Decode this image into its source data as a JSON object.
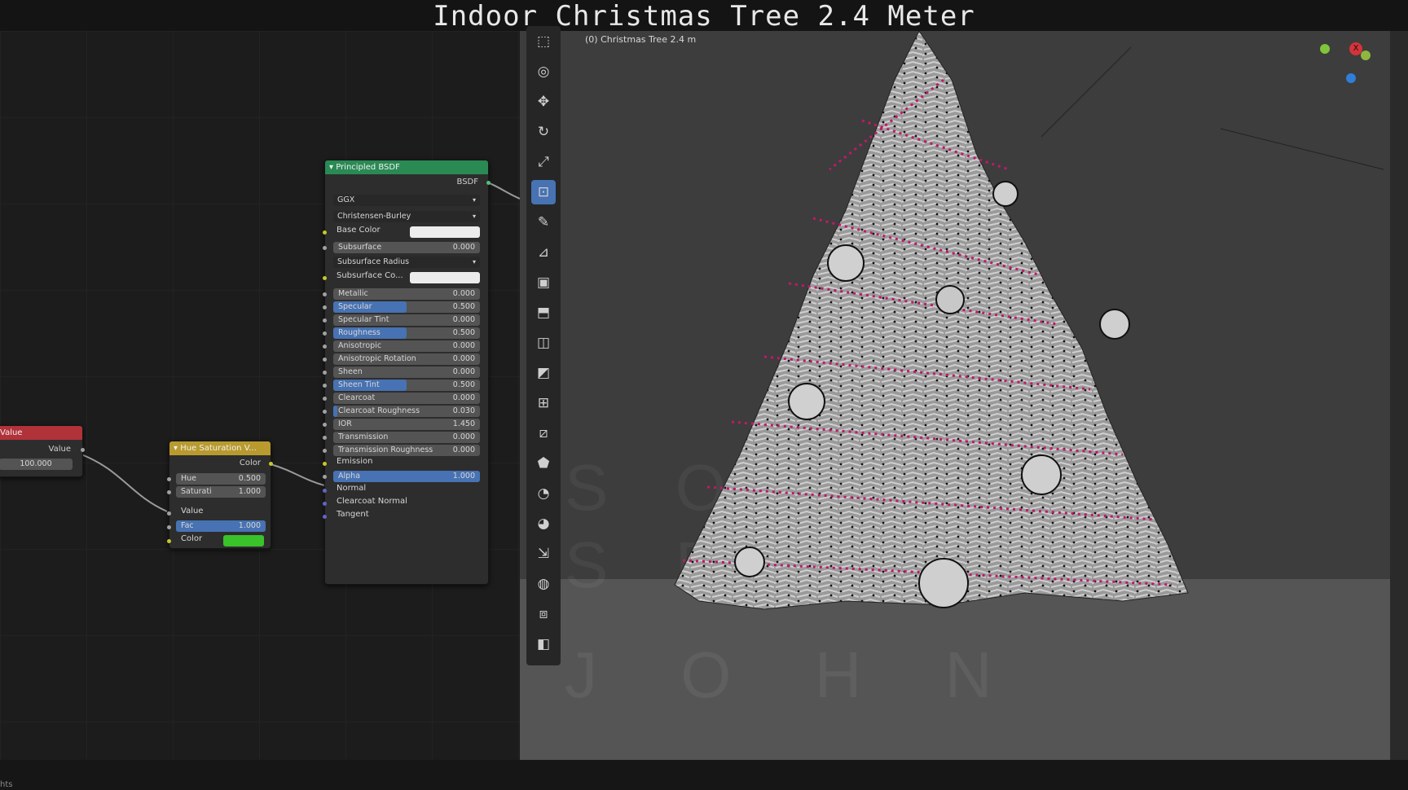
{
  "video_title": "Indoor Christmas Tree 2.4 Meter",
  "viewport": {
    "object_label": "(0) Christmas Tree 2.4 m",
    "watermark_lines": [
      "S O F",
      "S E",
      "J O H N"
    ],
    "gizmo_x_label": "X"
  },
  "nodes": {
    "value_node": {
      "title": "Value",
      "output_label": "Value",
      "value": "100.000",
      "header_color": "#b2323a"
    },
    "hue_sat_node": {
      "title": "Hue Saturation V...",
      "output_label": "Color",
      "header_color": "#b89a2e",
      "fields": [
        {
          "label": "Hue",
          "value": "0.500",
          "fill": 0
        },
        {
          "label": "Saturati",
          "value": "1.000",
          "fill": 0
        }
      ],
      "value_label": "Value",
      "fac": {
        "label": "Fac",
        "value": "1.000",
        "fill": 1.0
      },
      "color_label": "Color",
      "color_swatch": "#39c22a"
    },
    "bsdf_node": {
      "title": "Principled BSDF",
      "header_color": "#2a8a54",
      "output_label": "BSDF",
      "distribution": "GGX",
      "subsurface_method": "Christensen-Burley",
      "base_color_label": "Base Color",
      "subsurface_color_label": "Subsurface Co...",
      "subsurface_radius_label": "Subsurface Radius",
      "fields": [
        {
          "label": "Subsurface",
          "value": "0.000",
          "fill": 0
        },
        {
          "label": "Metallic",
          "value": "0.000",
          "fill": 0
        },
        {
          "label": "Specular",
          "value": "0.500",
          "fill": 0.5
        },
        {
          "label": "Specular Tint",
          "value": "0.000",
          "fill": 0
        },
        {
          "label": "Roughness",
          "value": "0.500",
          "fill": 0.5
        },
        {
          "label": "Anisotropic",
          "value": "0.000",
          "fill": 0
        },
        {
          "label": "Anisotropic Rotation",
          "value": "0.000",
          "fill": 0
        },
        {
          "label": "Sheen",
          "value": "0.000",
          "fill": 0
        },
        {
          "label": "Sheen Tint",
          "value": "0.500",
          "fill": 0.5
        },
        {
          "label": "Clearcoat",
          "value": "0.000",
          "fill": 0
        },
        {
          "label": "Clearcoat Roughness",
          "value": "0.030",
          "fill": 0.03
        },
        {
          "label": "IOR",
          "value": "1.450",
          "fill": 0
        },
        {
          "label": "Transmission",
          "value": "0.000",
          "fill": 0
        },
        {
          "label": "Transmission Roughness",
          "value": "0.000",
          "fill": 0
        },
        {
          "label": "Alpha",
          "value": "1.000",
          "fill": 1.0
        }
      ],
      "inputs_plain": [
        "Emission",
        "Normal",
        "Clearcoat Normal",
        "Tangent"
      ]
    }
  },
  "toolbar": {
    "tools": [
      "select-box-icon",
      "cursor-icon",
      "move-icon",
      "rotate-icon",
      "scale-icon",
      "transform-icon",
      "annotate-icon",
      "measure-icon",
      "add-cube-icon",
      "extrude-icon",
      "inset-icon",
      "bevel-icon",
      "loop-cut-icon",
      "knife-icon",
      "poly-build-icon",
      "spin-icon",
      "smooth-icon",
      "edge-slide-icon",
      "shrink-fatten-icon",
      "shear-icon",
      "rip-icon"
    ],
    "active_index": 5
  },
  "bottom_text": "hts",
  "colors": {
    "accent": "#4772b3",
    "ornament_lights": "#c2186b"
  }
}
